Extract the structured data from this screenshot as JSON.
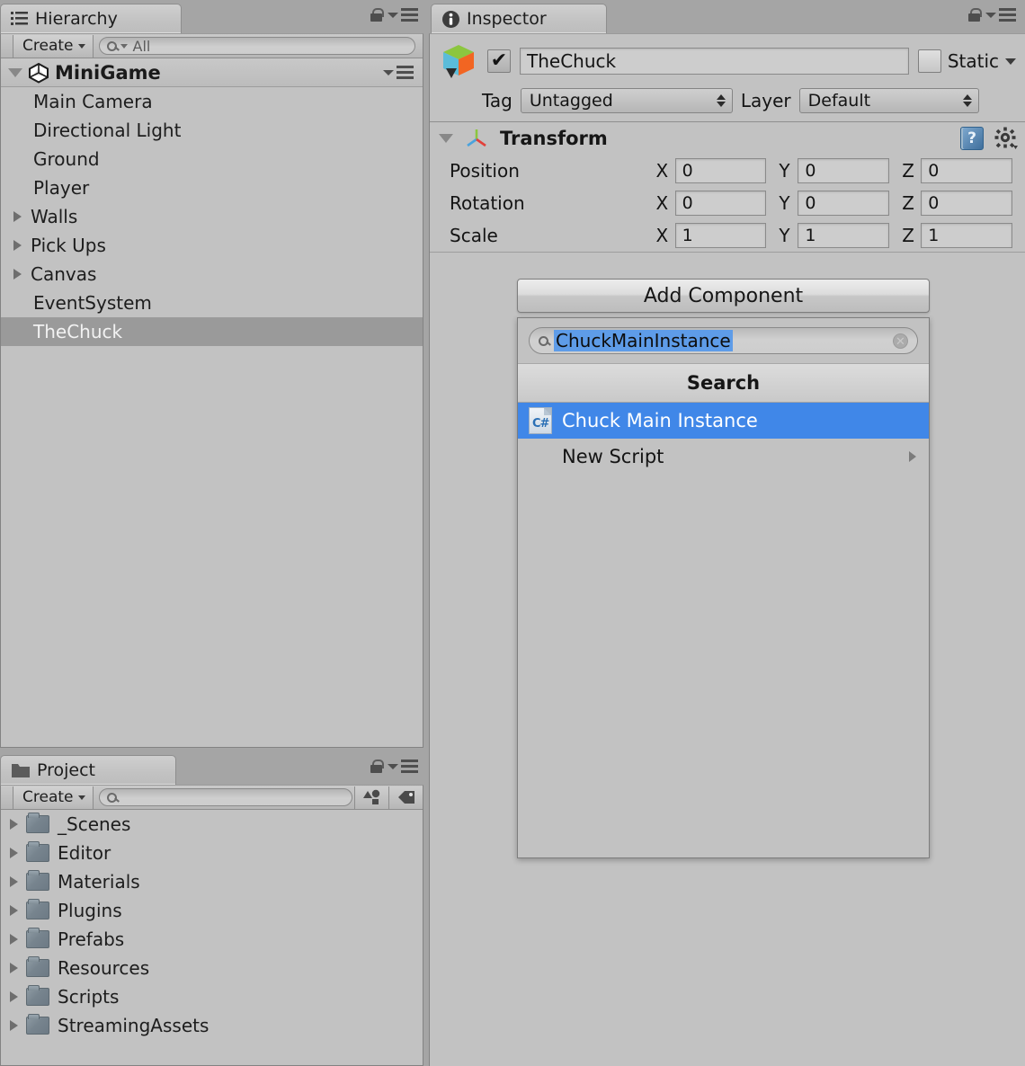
{
  "hierarchy": {
    "tab_label": "Hierarchy",
    "tab_icon": "hierarchy-list-icon",
    "create_label": "Create",
    "search_placeholder": "All",
    "search_value": "",
    "root": {
      "label": "MiniGame",
      "icon": "unity-logo-icon",
      "expanded": true
    },
    "items": [
      {
        "label": "Main Camera",
        "expandable": false,
        "selected": false
      },
      {
        "label": "Directional Light",
        "expandable": false,
        "selected": false
      },
      {
        "label": "Ground",
        "expandable": false,
        "selected": false
      },
      {
        "label": "Player",
        "expandable": false,
        "selected": false
      },
      {
        "label": "Walls",
        "expandable": true,
        "selected": false
      },
      {
        "label": "Pick Ups",
        "expandable": true,
        "selected": false
      },
      {
        "label": "Canvas",
        "expandable": true,
        "selected": false
      },
      {
        "label": "EventSystem",
        "expandable": false,
        "selected": false
      },
      {
        "label": "TheChuck",
        "expandable": false,
        "selected": true
      }
    ]
  },
  "project": {
    "tab_label": "Project",
    "tab_icon": "folder-icon",
    "create_label": "Create",
    "search_placeholder": "",
    "search_value": "",
    "toolbar_icons": [
      "asset-filter-icon",
      "label-tag-icon"
    ],
    "folders": [
      {
        "label": "_Scenes"
      },
      {
        "label": "Editor"
      },
      {
        "label": "Materials"
      },
      {
        "label": "Plugins"
      },
      {
        "label": "Prefabs"
      },
      {
        "label": "Resources"
      },
      {
        "label": "Scripts"
      },
      {
        "label": "StreamingAssets"
      }
    ]
  },
  "inspector": {
    "tab_label": "Inspector",
    "tab_icon": "info-circle-icon",
    "object": {
      "enabled": true,
      "name": "TheChuck",
      "icon": "game-object-cube-icon",
      "static_label": "Static",
      "static_checked": false,
      "tag_label": "Tag",
      "tag_value": "Untagged",
      "layer_label": "Layer",
      "layer_value": "Default"
    },
    "transform": {
      "title": "Transform",
      "expanded": true,
      "icon": "transform-axis-icon",
      "help_icon": "help-book-icon",
      "settings_icon": "gear-icon",
      "rows": [
        {
          "name": "Position",
          "x": "0",
          "y": "0",
          "z": "0"
        },
        {
          "name": "Rotation",
          "x": "0",
          "y": "0",
          "z": "0"
        },
        {
          "name": "Scale",
          "x": "1",
          "y": "1",
          "z": "1"
        }
      ],
      "axes": {
        "x": "X",
        "y": "Y",
        "z": "Z"
      }
    },
    "add_component": {
      "button_label": "Add Component",
      "search_value": "ChuckMainInstance",
      "search_selected": true,
      "section_header": "Search",
      "results": [
        {
          "label": "Chuck Main Instance",
          "icon": "csharp-script-icon",
          "selected": true,
          "submenu": false
        },
        {
          "label": "New Script",
          "icon": null,
          "selected": false,
          "submenu": true
        }
      ]
    }
  },
  "colors": {
    "panel_bg": "#c2c2c2",
    "window_bg": "#a5a5a5",
    "selection_blue": "#4087e8",
    "text_selection_blue": "#5e9ce8",
    "row_selected_gray": "#9a9a9a"
  }
}
